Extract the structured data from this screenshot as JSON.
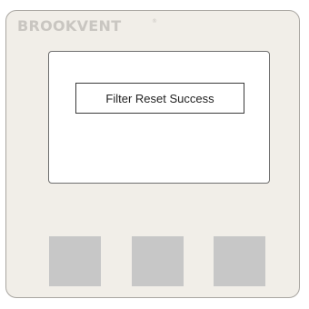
{
  "device": {
    "brand": "BROOKVENT",
    "brand_mark": "®"
  },
  "screen": {
    "message": "Filter Reset Success"
  },
  "buttons": [
    {
      "name": "left"
    },
    {
      "name": "middle"
    },
    {
      "name": "right"
    }
  ],
  "colors": {
    "panel": "#f1eee8",
    "brand_text": "#c9c6c1",
    "screen": "#ffffff",
    "button": "#c7c7c7"
  }
}
